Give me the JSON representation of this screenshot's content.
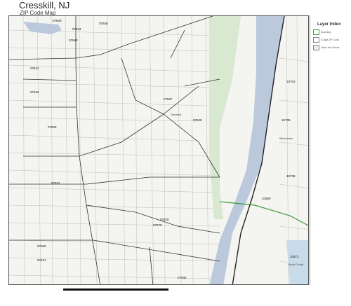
{
  "title": "Cresskill, NJ",
  "subtitle": "ZIP Code Map",
  "legend": {
    "title": "Layer Index",
    "items": [
      {
        "label": "Boundary",
        "color": "#3a9a3a"
      },
      {
        "label": "5-Digit ZIP Code",
        "color": "#cccccc"
      },
      {
        "label": "Cities and Towns",
        "color": "#eeeeee"
      }
    ]
  },
  "zip_labels": [
    "07630",
    "07624",
    "07640",
    "07648",
    "07641",
    "07626",
    "07627",
    "07628",
    "07646",
    "07620",
    "07631",
    "07621",
    "07660",
    "07670",
    "07632",
    "10701",
    "10705",
    "10708",
    "10471",
    "10469"
  ],
  "place_labels": [
    "Demarest",
    "Westchester",
    "Bronx County"
  ],
  "colors": {
    "map_bg": "#f4f4f1",
    "zip_boundary": "#333333",
    "state_line": "#3a9a3a",
    "county_line": "#222222",
    "water": "#bcc9dd",
    "park": "#d9e8d0"
  }
}
